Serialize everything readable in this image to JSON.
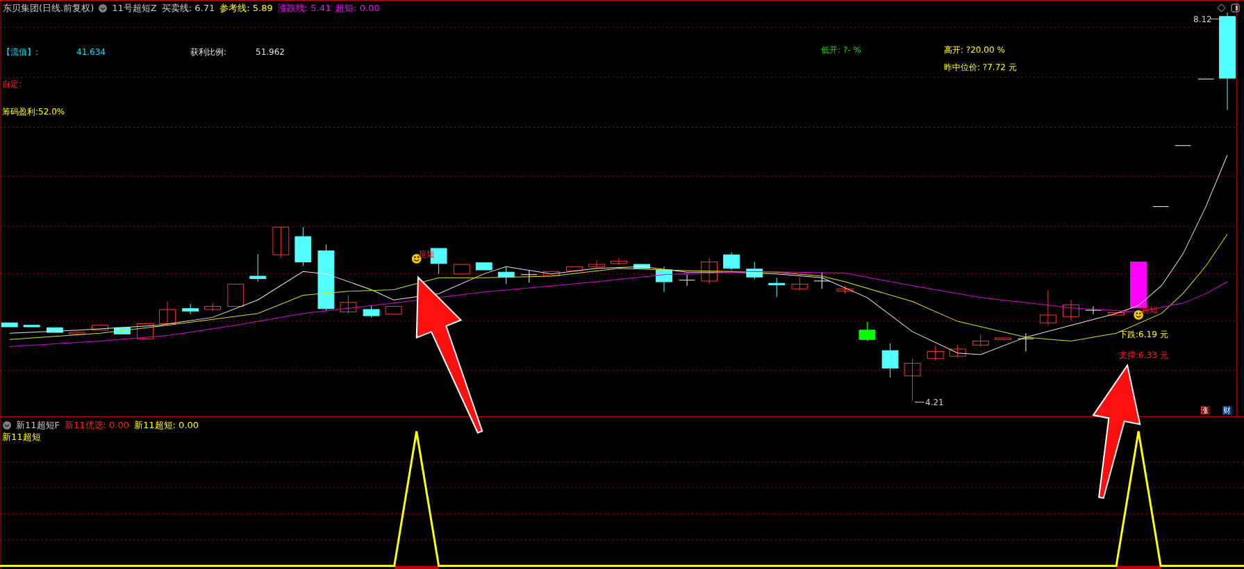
{
  "header": {
    "title": "东贝集团(日线.前复权)",
    "indicator": "11号超短Z",
    "values": [
      {
        "label": "买卖线:",
        "value": "6.71",
        "color": "#d0d0d0"
      },
      {
        "label": "参考线:",
        "value": "5.89",
        "color": "#ffff00"
      },
      {
        "label": "涨跌线:",
        "value": "5.41",
        "color": "#ff00ff"
      },
      {
        "label": "超短:",
        "value": "0.00",
        "color": "#ff00ff"
      }
    ]
  },
  "stats": {
    "float_value": {
      "label": "【流值】:",
      "value": "41.634"
    },
    "profit_ratio": {
      "label": "获利比例:",
      "value": "51.962"
    },
    "low_open": "低开: ?- %",
    "high_open": "高开: ?20.00 %",
    "prev_mid_price": "昨中位价: ?7.72 元",
    "custom": "自定:",
    "chip_profit": "筹码盈利:52.0%"
  },
  "signals": [
    {
      "text": "超短"
    },
    {
      "text": "超短"
    }
  ],
  "price_marks": {
    "high": "8.12",
    "low": "4.21"
  },
  "levels": {
    "fall": "下跌:6.19 元",
    "support": "支撑:6.33 元"
  },
  "badges": [
    {
      "text": "涨",
      "color": "#7a0000"
    },
    {
      "text": "财",
      "color": "#003a70"
    }
  ],
  "sub_panel": {
    "indicator": "新11超短F",
    "values": [
      {
        "label": "新11优选:",
        "value": "0.00",
        "color": "#ff2020"
      },
      {
        "label": "新11超短:",
        "value": "0.00",
        "color": "#ffff00"
      }
    ],
    "legend": "新11超短"
  }
}
